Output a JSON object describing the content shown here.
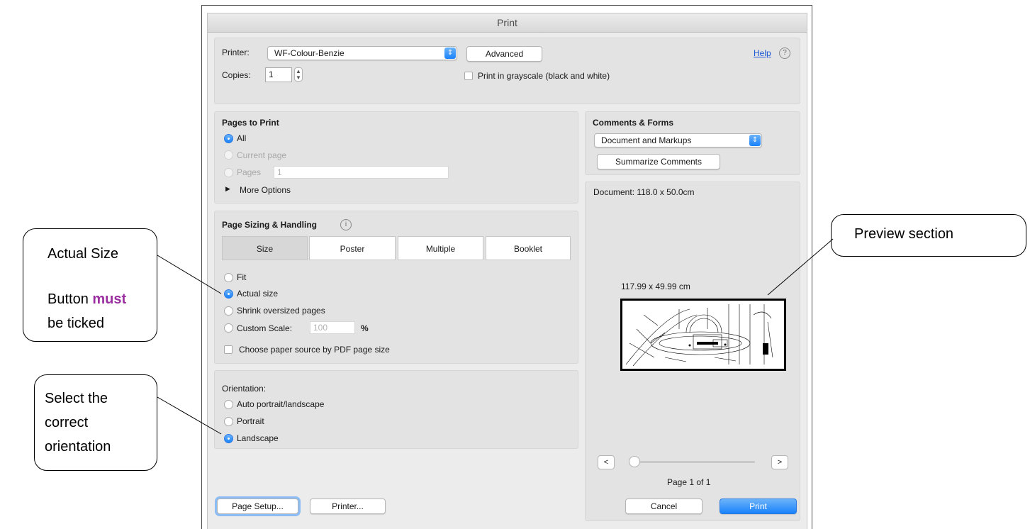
{
  "dialog": {
    "title": "Print",
    "printer_label": "Printer:",
    "printer_value": "WF-Colour-Benzie",
    "advanced_button": "Advanced",
    "help_link": "Help",
    "help_icon": "?",
    "copies_label": "Copies:",
    "copies_value": "1",
    "grayscale_label": "Print in grayscale (black and white)"
  },
  "pages_to_print": {
    "heading": "Pages to Print",
    "all": "All",
    "current_page": "Current page",
    "pages": "Pages",
    "pages_value": "1",
    "more_options": "More Options"
  },
  "page_sizing": {
    "heading": "Page Sizing & Handling",
    "info_icon": "i",
    "tabs": [
      "Size",
      "Poster",
      "Multiple",
      "Booklet"
    ],
    "fit": "Fit",
    "actual_size": "Actual size",
    "shrink": "Shrink oversized pages",
    "custom_scale": "Custom Scale:",
    "custom_scale_value": "100",
    "percent": "%",
    "paper_source": "Choose paper source by PDF page size"
  },
  "orientation": {
    "heading": "Orientation:",
    "auto": "Auto portrait/landscape",
    "portrait": "Portrait",
    "landscape": "Landscape"
  },
  "comments_forms": {
    "heading": "Comments & Forms",
    "selected": "Document and Markups",
    "summarize_button": "Summarize Comments"
  },
  "preview": {
    "document_size": "Document: 118.0 x 50.0cm",
    "page_size": "117.99 x 49.99 cm",
    "prev": "<",
    "next": ">",
    "page_indicator": "Page 1 of 1",
    "slider_position": 0
  },
  "footer": {
    "page_setup": "Page Setup...",
    "printer": "Printer...",
    "cancel": "Cancel",
    "print": "Print"
  },
  "callouts": {
    "actual_size_line1": "Actual Size",
    "actual_size_line2a": "Button ",
    "actual_size_emph": "must",
    "actual_size_line3": "be ticked",
    "orientation_line1": "Select the",
    "orientation_line2": "correct",
    "orientation_line3": "orientation",
    "preview": "Preview section"
  },
  "colors": {
    "accent": "#1a82fb",
    "emphasis": "#9b2fa0"
  }
}
